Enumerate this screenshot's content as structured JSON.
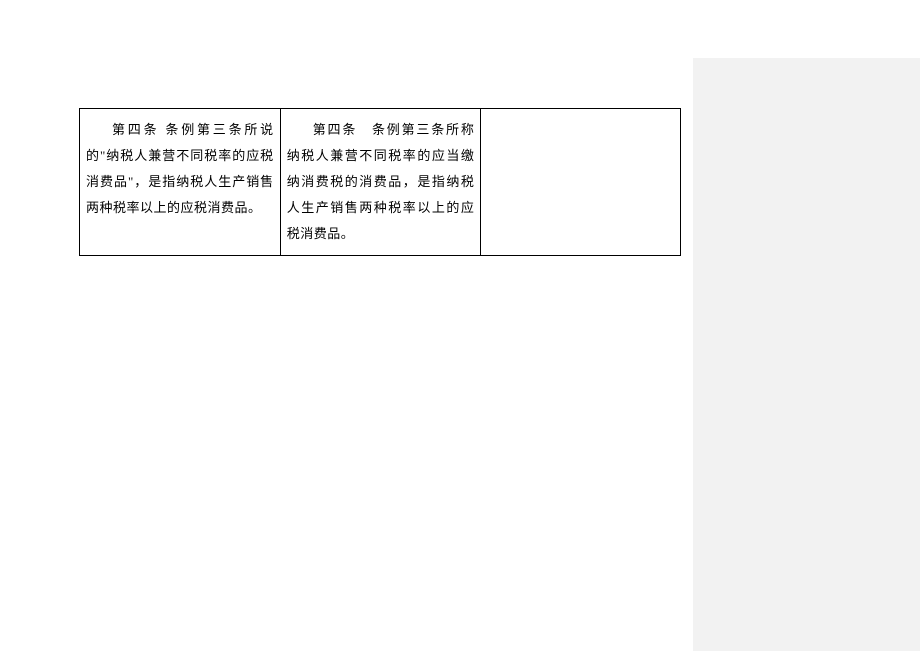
{
  "table": {
    "cells": {
      "left": "第四条 条例第三条所说的\"纳税人兼营不同税率的应税消费品\"，是指纳税人生产销售两种税率以上的应税消费品。",
      "middle": "第四条　条例第三条所称纳税人兼营不同税率的应当缴纳消费税的消费品，是指纳税人生产销售两种税率以上的应税消费品。",
      "right": ""
    }
  }
}
